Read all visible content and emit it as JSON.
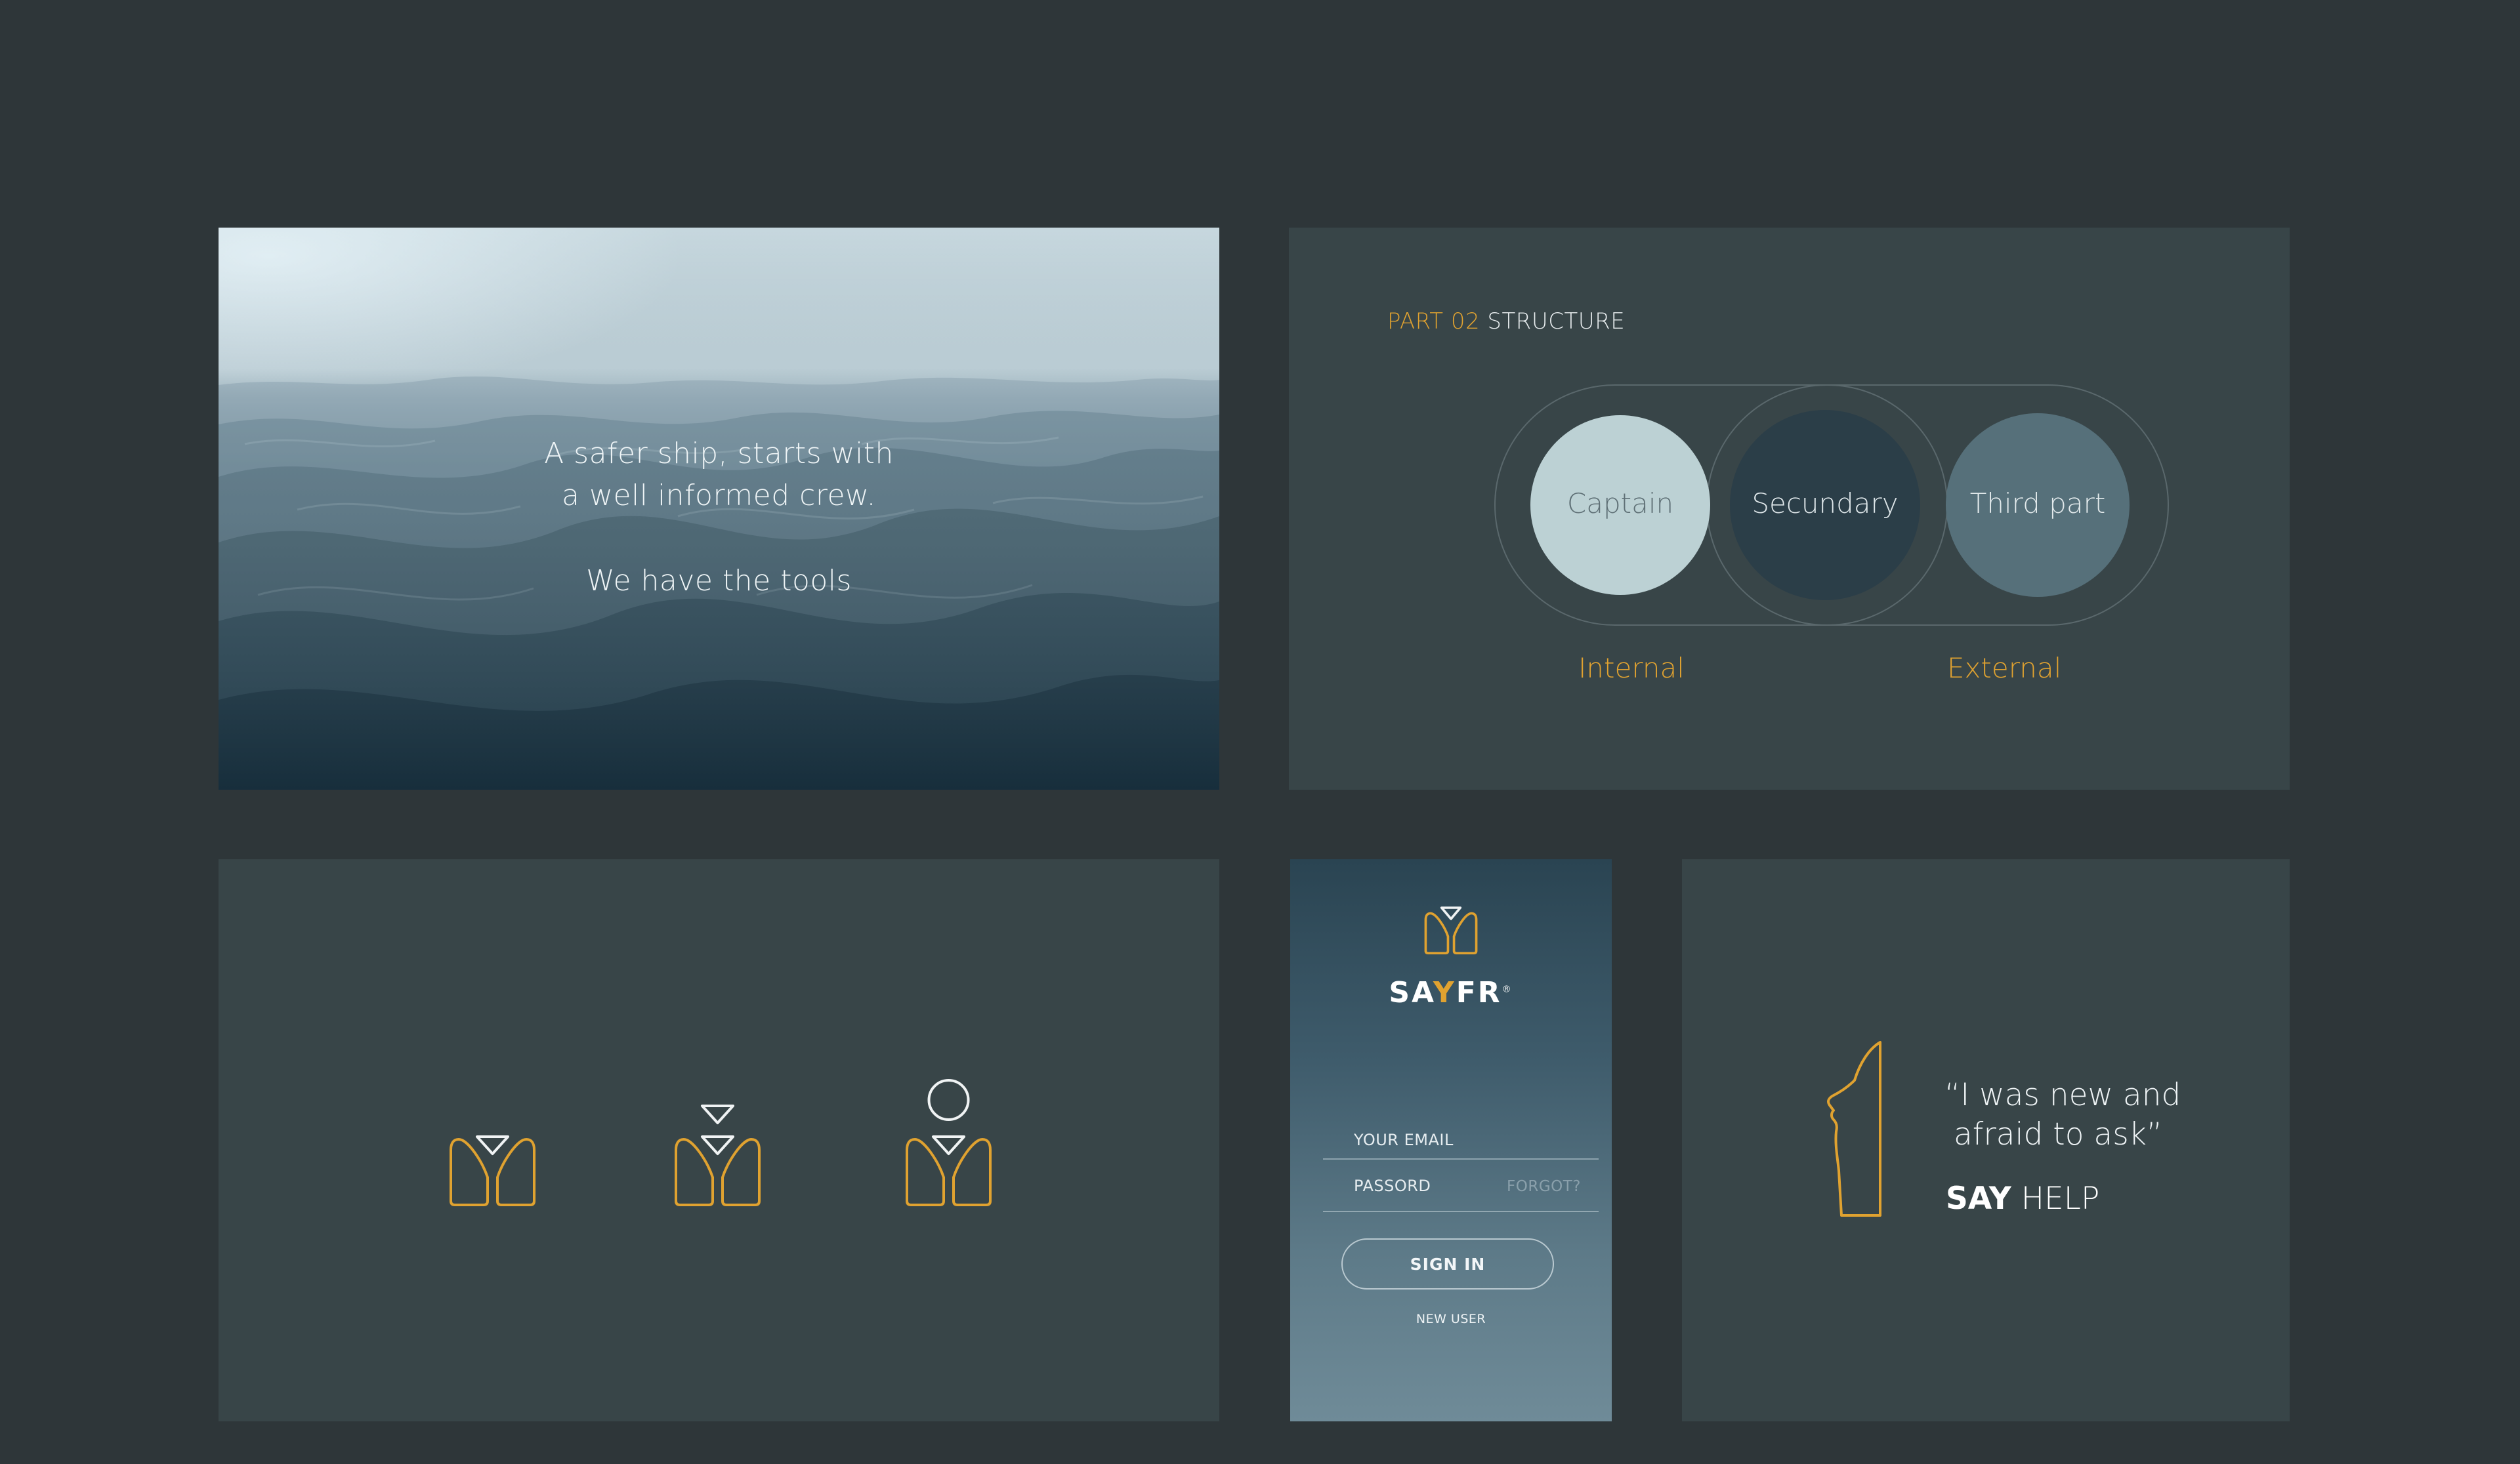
{
  "hero": {
    "line1": "A safer ship, starts with",
    "line2": "a well informed crew.",
    "line3": "We have the tools"
  },
  "structure": {
    "part_number": "PART 02",
    "part_name": "STRUCTURE",
    "circles": [
      {
        "label": "Captain",
        "fill": "#bcd1d4",
        "text_color": "#5e6f75"
      },
      {
        "label": "Secundary",
        "fill": "#2b3e48",
        "text_color": "#dfe7ea"
      },
      {
        "label": "Third part",
        "fill": "#56707a",
        "text_color": "#e3eaec"
      }
    ],
    "group_labels": {
      "internal": "Internal",
      "external": "External"
    }
  },
  "icons": {
    "variants": [
      "crew-icon",
      "crew-stacked-icon",
      "crew-person-icon"
    ]
  },
  "login": {
    "brand_prefix": "SA",
    "brand_highlight": "Y",
    "brand_suffix": "FR",
    "brand_mark": "®",
    "email_placeholder": "YOUR EMAIL",
    "password_placeholder": "PASSORD",
    "forgot_link": "FORGOT?",
    "sign_in_button": "SIGN IN",
    "new_user_link": "NEW USER"
  },
  "quote": {
    "line1": "“I was new and",
    "line2": "afraid to ask”",
    "say": "SAY",
    "help": "HELP"
  },
  "colors": {
    "background": "#2e3639",
    "card": "#384548",
    "accent": "#e0a230"
  }
}
